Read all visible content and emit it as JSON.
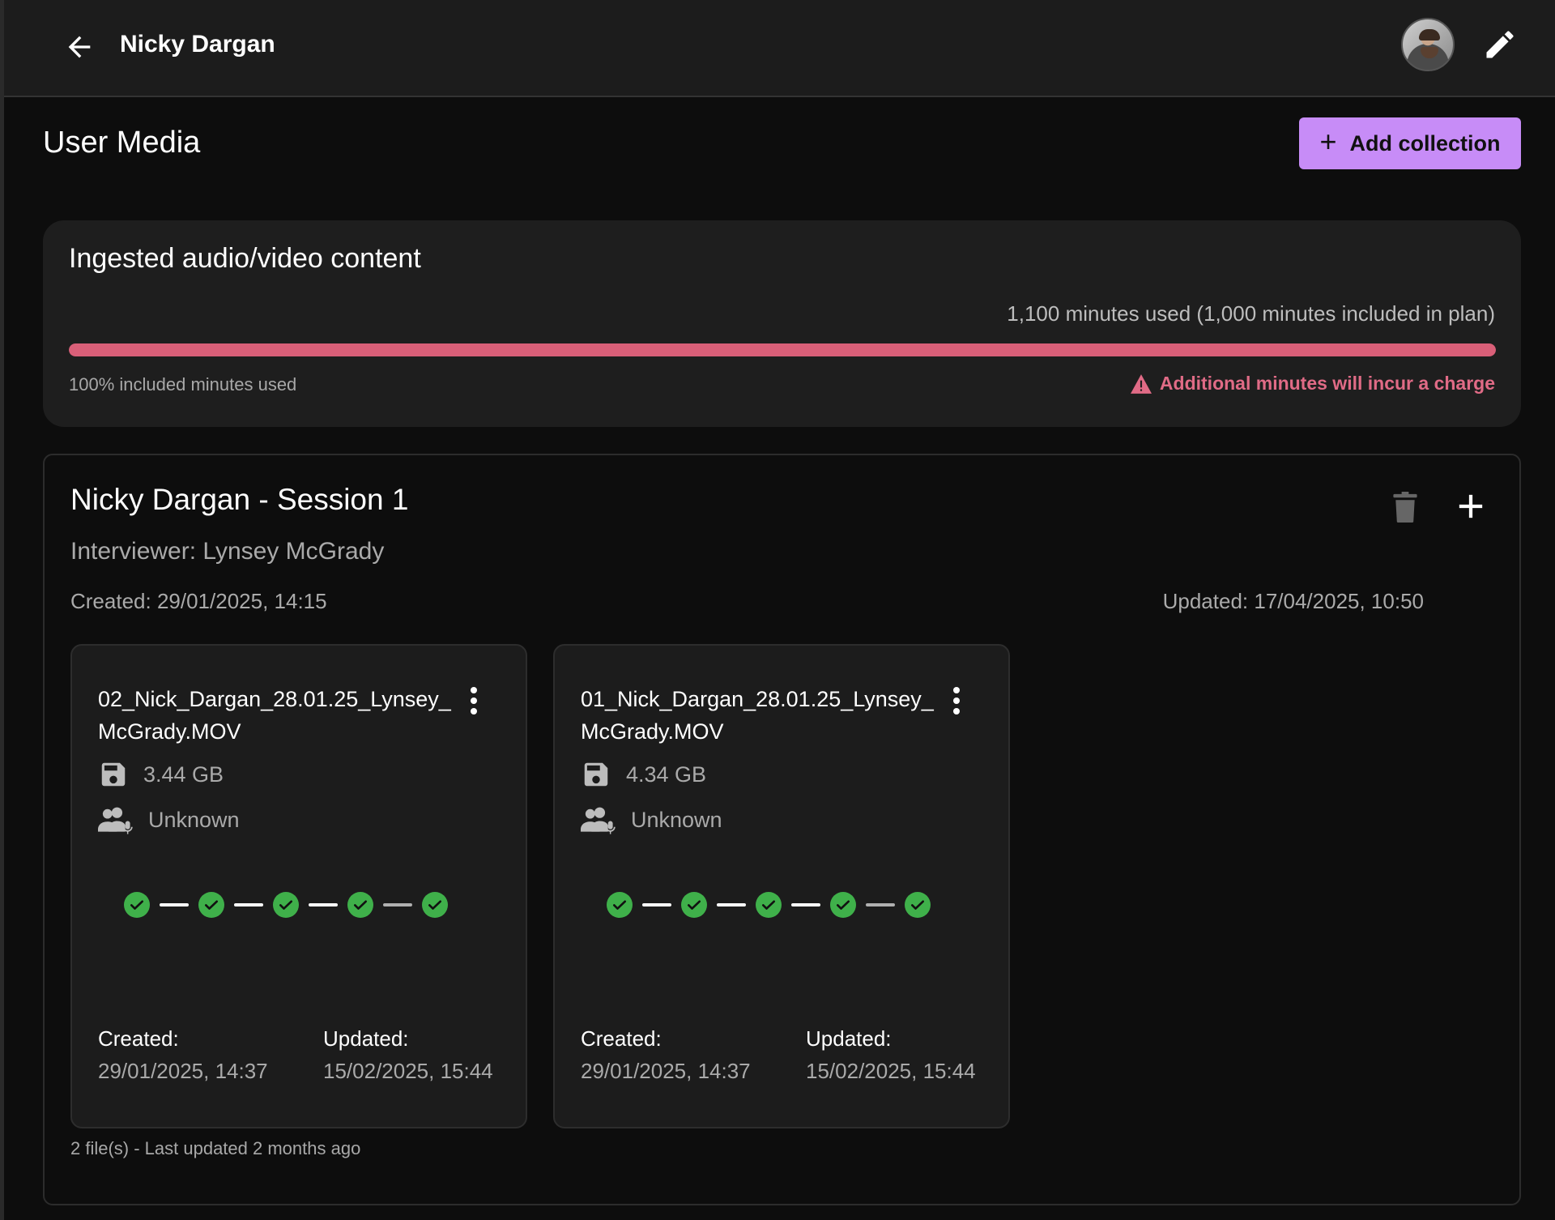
{
  "header": {
    "title": "Nicky Dargan"
  },
  "page": {
    "title": "User Media",
    "add_collection_label": "Add collection"
  },
  "usage": {
    "title": "Ingested audio/video content",
    "used_text": "1,100 minutes used (1,000 minutes included in plan)",
    "percent_text": "100% included minutes used",
    "warning_text": "Additional minutes will incur a charge",
    "progress_fraction": 1.0,
    "bar_color": "#d95f78",
    "warning_color": "#e06b86"
  },
  "session": {
    "title": "Nicky Dargan - Session 1",
    "interviewer": "Interviewer: Lynsey McGrady",
    "created": "Created: 29/01/2025, 14:15",
    "updated": "Updated: 17/04/2025, 10:50",
    "footer": "2 file(s) - Last updated 2 months ago",
    "files": [
      {
        "name": "02_Nick_Dargan_28.01.25_Lynsey_McGrady.MOV",
        "size": "3.44 GB",
        "speaker": "Unknown",
        "created_label": "Created:",
        "created_value": "29/01/2025, 14:37",
        "updated_label": "Updated:",
        "updated_value": "15/02/2025, 15:44",
        "steps_completed": 5
      },
      {
        "name": "01_Nick_Dargan_28.01.25_Lynsey_McGrady.MOV",
        "size": "4.34 GB",
        "speaker": "Unknown",
        "created_label": "Created:",
        "created_value": "29/01/2025, 14:37",
        "updated_label": "Updated:",
        "updated_value": "15/02/2025, 15:44",
        "steps_completed": 5
      }
    ]
  },
  "colors": {
    "accent": "#c78cf7",
    "success": "#3fb04a"
  },
  "icons": {
    "back": "arrow-left-icon",
    "edit": "pencil-icon",
    "add": "plus-icon",
    "trash": "trash-icon",
    "kebab": "more-vertical-icon",
    "size": "floppy-disk-icon",
    "speaker": "users-microphone-icon",
    "warning": "warning-triangle-icon",
    "step": "check-circle-icon"
  }
}
